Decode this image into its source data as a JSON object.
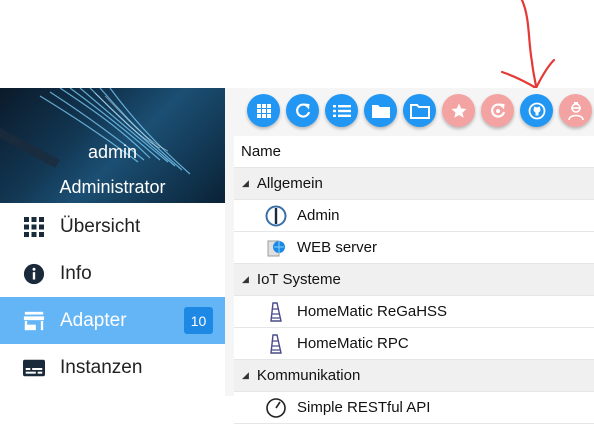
{
  "colors": {
    "accent": "#2196f3",
    "active_nav_bg": "#64b5f6",
    "badge_bg": "#1e88e5",
    "disabled_button": "#f4a3a3",
    "annotation": "#e53935"
  },
  "profile": {
    "name": "admin",
    "role": "Administrator"
  },
  "sidebar": {
    "items": [
      {
        "label": "Übersicht",
        "icon": "grid-icon"
      },
      {
        "label": "Info",
        "icon": "info-icon"
      },
      {
        "label": "Adapter",
        "icon": "store-icon",
        "active": true,
        "badge": "10"
      },
      {
        "label": "Instanzen",
        "icon": "instances-icon"
      }
    ]
  },
  "toolbar": {
    "buttons": [
      {
        "icon": "grid-view-icon",
        "state": "enabled"
      },
      {
        "icon": "refresh-icon",
        "state": "enabled"
      },
      {
        "icon": "list-view-icon",
        "state": "enabled"
      },
      {
        "icon": "folder-closed-icon",
        "state": "enabled"
      },
      {
        "icon": "folder-open-icon",
        "state": "enabled"
      },
      {
        "icon": "star-icon",
        "state": "disabled"
      },
      {
        "icon": "update-icon",
        "state": "disabled"
      },
      {
        "icon": "github-icon",
        "state": "enabled"
      },
      {
        "icon": "expert-mode-icon",
        "state": "disabled"
      }
    ]
  },
  "table": {
    "header": "Name",
    "groups": [
      {
        "label": "Allgemein",
        "items": [
          {
            "label": "Admin",
            "icon": "admin-adapter-icon"
          },
          {
            "label": "WEB server",
            "icon": "web-server-icon"
          }
        ]
      },
      {
        "label": "IoT Systeme",
        "items": [
          {
            "label": "HomeMatic ReGaHSS",
            "icon": "homematic-icon"
          },
          {
            "label": "HomeMatic RPC",
            "icon": "homematic-icon"
          }
        ]
      },
      {
        "label": "Kommunikation",
        "items": [
          {
            "label": "Simple RESTful API",
            "icon": "rest-api-icon"
          }
        ]
      }
    ]
  }
}
